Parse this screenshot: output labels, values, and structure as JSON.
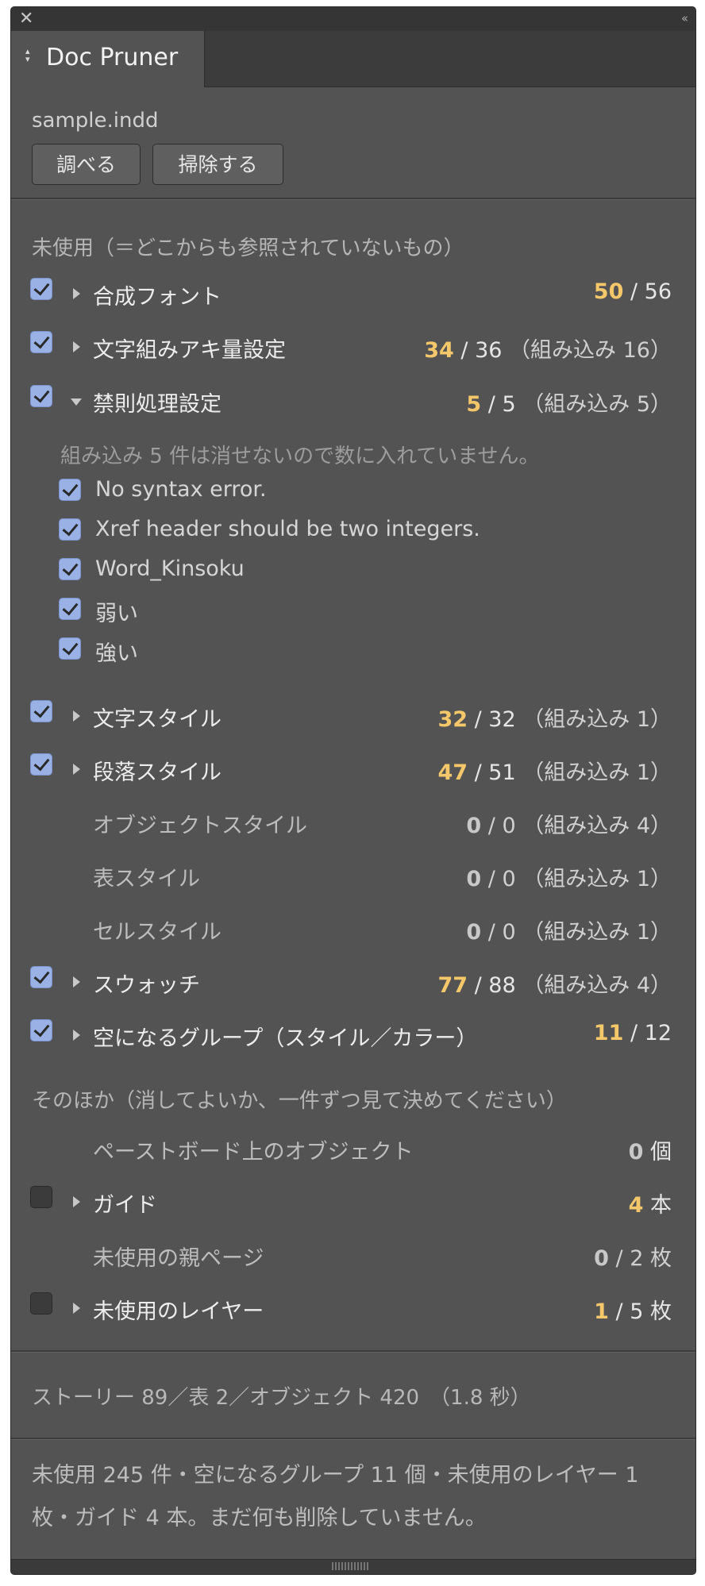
{
  "window": {
    "close_glyph": "✕",
    "collapse_glyph": "‹‹"
  },
  "tab": {
    "arrows": "◇",
    "title": "Doc Pruner"
  },
  "file": {
    "name": "sample.indd"
  },
  "buttons": {
    "inspect": "調べる",
    "clean": "掃除する"
  },
  "unused_section": {
    "heading": "未使用（＝どこからも参照されていないもの）",
    "rows": [
      {
        "label": "合成フォント",
        "checked": true,
        "expander": "right",
        "count": "50",
        "total": " / 56",
        "builtin": ""
      },
      {
        "label": "文字組みアキ量設定",
        "checked": true,
        "expander": "right",
        "count": "34",
        "total": " / 36",
        "builtin": "（組み込み 16）"
      },
      {
        "label": "禁則処理設定",
        "checked": true,
        "expander": "down",
        "count": "5",
        "total": " / 5",
        "builtin": "（組み込み 5）"
      }
    ],
    "expanded_note": "組み込み 5 件は消せないので数に入れていません。",
    "sub_items": [
      "No syntax error.",
      "Xref header should be two integers.",
      "Word_Kinsoku",
      "弱い",
      "強い"
    ],
    "rows2": [
      {
        "label": "文字スタイル",
        "checked": true,
        "expander": "right",
        "count": "32",
        "total": " / 32",
        "builtin": "（組み込み 1）"
      },
      {
        "label": "段落スタイル",
        "checked": true,
        "expander": "right",
        "count": "47",
        "total": " / 51",
        "builtin": "（組み込み 1）"
      },
      {
        "label": "オブジェクトスタイル",
        "checked": null,
        "expander": "",
        "count": "0",
        "total": " / 0",
        "builtin": "（組み込み 4）"
      },
      {
        "label": "表スタイル",
        "checked": null,
        "expander": "",
        "count": "0",
        "total": " / 0",
        "builtin": "（組み込み 1）"
      },
      {
        "label": "セルスタイル",
        "checked": null,
        "expander": "",
        "count": "0",
        "total": " / 0",
        "builtin": "（組み込み 1）"
      },
      {
        "label": "スウォッチ",
        "checked": true,
        "expander": "right",
        "count": "77",
        "total": " / 88",
        "builtin": "（組み込み 4）"
      },
      {
        "label": "空になるグループ（スタイル／カラー）",
        "checked": true,
        "expander": "right",
        "count": "11",
        "total": " / 12",
        "builtin": ""
      }
    ]
  },
  "other_section": {
    "heading": "そのほか（消してよいか、一件ずつ見て決めてください）",
    "rows": [
      {
        "label": "ペーストボード上のオブジェクト",
        "checked": null,
        "expander": "",
        "count": "0",
        "total": " 個"
      },
      {
        "label": "ガイド",
        "checked": false,
        "expander": "right",
        "count": "4",
        "total": " 本"
      },
      {
        "label": "未使用の親ページ",
        "checked": null,
        "expander": "",
        "count": "0",
        "total": " / 2 枚"
      },
      {
        "label": "未使用のレイヤー",
        "checked": false,
        "expander": "right",
        "count": "1",
        "total": " / 5 枚"
      }
    ]
  },
  "stats": "ストーリー 89／表 2／オブジェクト 420　（1.8 秒）",
  "summary": "未使用 245 件・空になるグループ 11 個・未使用のレイヤー 1 枚・ガイド 4 本。まだ何も削除していません。"
}
